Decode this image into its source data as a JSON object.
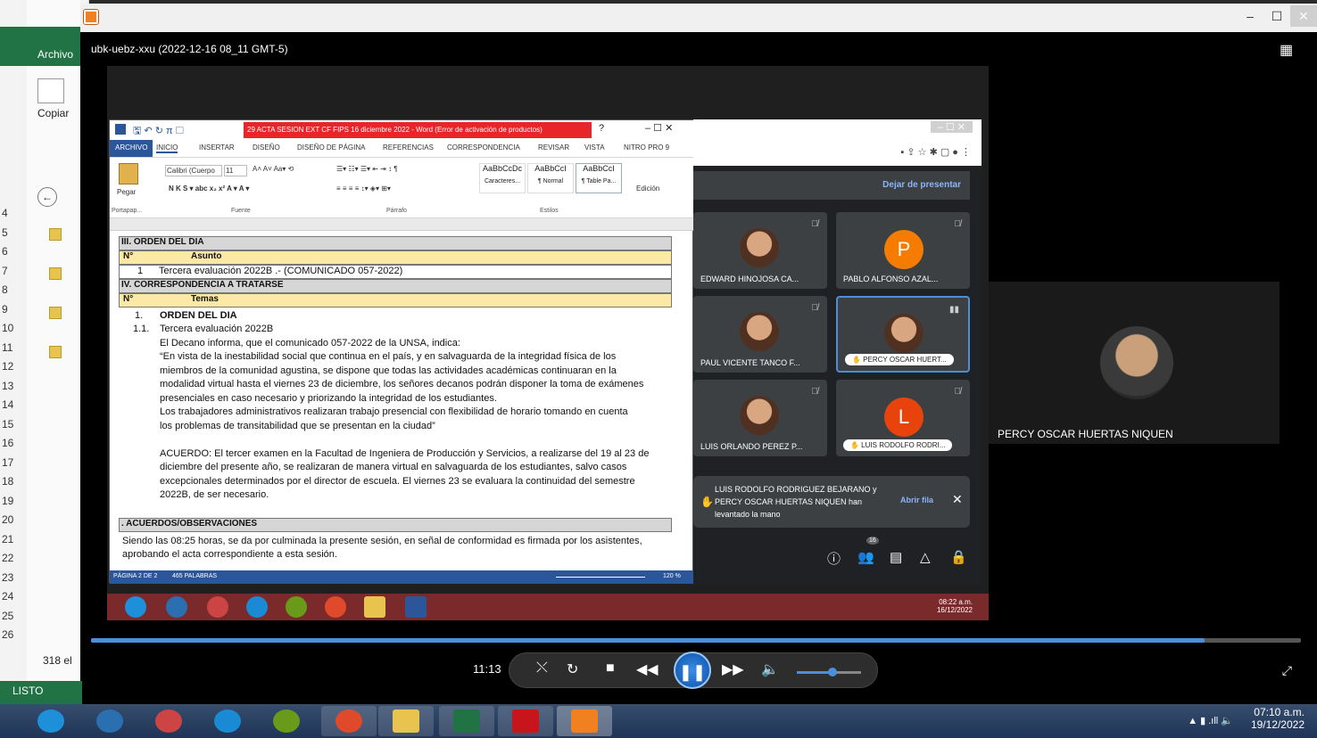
{
  "excel_bg": {
    "ribbon_tab": "Archivo",
    "copy_label": "Copiar",
    "status": "LISTO",
    "count": "318 el",
    "row_numbers": [
      "4",
      "5",
      "6",
      "7",
      "8",
      "9",
      "10",
      "11",
      "12",
      "13",
      "14",
      "15",
      "16",
      "17",
      "18",
      "19",
      "20",
      "21",
      "22",
      "23",
      "24",
      "25",
      "26"
    ]
  },
  "player": {
    "title": "ubk-uebz-xxu (2022-12-16 08_11 GMT-5)",
    "time": "11:13",
    "progress": 0.92,
    "volume": 0.55,
    "icons": [
      "repeat-icon",
      "replay-icon",
      "stop-icon",
      "rewind-icon",
      "pause-icon",
      "fast-forward-icon",
      "volume-icon",
      "fullscreen-icon"
    ]
  },
  "word": {
    "title": "29 ACTA SESION EXT CF FIPS 16 diciembre 2022 - Word (Error de activación de productos)",
    "tabs": [
      "ARCHIVO",
      "INICIO",
      "INSERTAR",
      "DISEÑO",
      "DISEÑO DE PÁGINA",
      "REFERENCIAS",
      "CORRESPONDENCIA",
      "REVISAR",
      "VISTA",
      "NITRO PRO 9"
    ],
    "ribbon": {
      "paste": "Pegar",
      "font_name": "Calibri (Cuerpo",
      "font_size": "11",
      "groups": [
        "Portapap...",
        "Fuente",
        "Párrafo",
        "Estilos"
      ],
      "styles": [
        {
          "sample": "AaBbCcDc",
          "label": "Caracteres..."
        },
        {
          "sample": "AaBbCcI",
          "label": "¶ Normal"
        },
        {
          "sample": "AaBbCcI",
          "label": "¶ Table Pa..."
        }
      ],
      "edit": "Edición"
    },
    "doc": {
      "sec3": "III. ORDEN DEL DIA",
      "n_label": "N°",
      "asunto": "Asunto",
      "item1_num": "1",
      "item1_text": "Tercera evaluación 2022B .- (COMUNICADO 057-2022)",
      "sec4": "IV. CORRESPONDENCIA A TRATARSE",
      "temas": "Temas",
      "t1_num": "1.",
      "t1_text": "ORDEN DEL DIA",
      "t11_num": "1.1.",
      "lines": [
        "Tercera evaluación 2022B",
        "El Decano informa, que el comunicado 057-2022 de la UNSA, indica:",
        "“En vista de la inestabilidad social que continua en el país, y en salvaguarda de la integridad física de los",
        "miembros de la comunidad agustina, se dispone que todas las actividades académicas continuaran en la",
        "modalidad virtual hasta el viernes 23 de diciembre, los señores decanos podrán disponer la toma de exámenes",
        "presenciales en caso necesario y priorizando la integridad de los estudiantes.",
        "Los trabajadores administrativos realizaran trabajo presencial con flexibilidad de horario tomando en cuenta",
        "los problemas de transitabilidad que se presentan en la ciudad”",
        "",
        "ACUERDO: El tercer examen en la Facultad de Ingeniera de Producción y Servicios, a realizarse del 19 al 23 de",
        "diciembre del presente año, se realizaran de manera virtual en salvaguarda de los estudiantes, salvo casos",
        "excepcionales determinados por el director de escuela. El viernes 23 se evaluara la continuidad del semestre",
        "2022B, de ser necesario."
      ],
      "sec5": ". ACUERDOS/OBSERVACIONES",
      "closing1": "Siendo las 08:25 horas, se da por culminada la presente sesión, en señal de conformidad es firmada por los asistentes,",
      "closing2": "aprobando el acta correspondiente a esta sesión."
    },
    "status": {
      "page": "PÁGINA 2 DE 2",
      "words": "465 PALABRAS",
      "zoom": "120 %"
    }
  },
  "meet": {
    "present_button": "Dejar de presentar",
    "participants": [
      {
        "name": "EDWARD HINOJOSA CA...",
        "kind": "photo"
      },
      {
        "name": "PABLO ALFONSO AZAL...",
        "kind": "letter",
        "letter": "P",
        "color": "#f57c00"
      },
      {
        "name": "PAUL VICENTE TANCO F...",
        "kind": "photo"
      },
      {
        "name": "PERCY OSCAR HUERT...",
        "kind": "photo",
        "hand": true,
        "speaking": true
      },
      {
        "name": "LUIS ORLANDO PEREZ P...",
        "kind": "photo"
      },
      {
        "name": "LUIS RODOLFO RODRI...",
        "kind": "letter",
        "letter": "L",
        "color": "#e8430c",
        "hand": true
      }
    ],
    "toast": "LUIS RODOLFO RODRIGUEZ BEJARANO y PERCY OSCAR HUERTAS NIQUEN han levantado la mano",
    "toast_action": "Abrir fila",
    "people_count": "16",
    "inner_time": "08:22 a.m.",
    "inner_date": "16/12/2022"
  },
  "big_tile_name": "PERCY OSCAR HUERTAS NIQUEN",
  "taskbar": {
    "time": "07:10 a.m.",
    "date": "19/12/2022"
  },
  "colors": {
    "word_blue": "#2b579a",
    "excel_green": "#217346",
    "accent_blue": "#4a8fdc",
    "error_red": "#e8262a"
  }
}
